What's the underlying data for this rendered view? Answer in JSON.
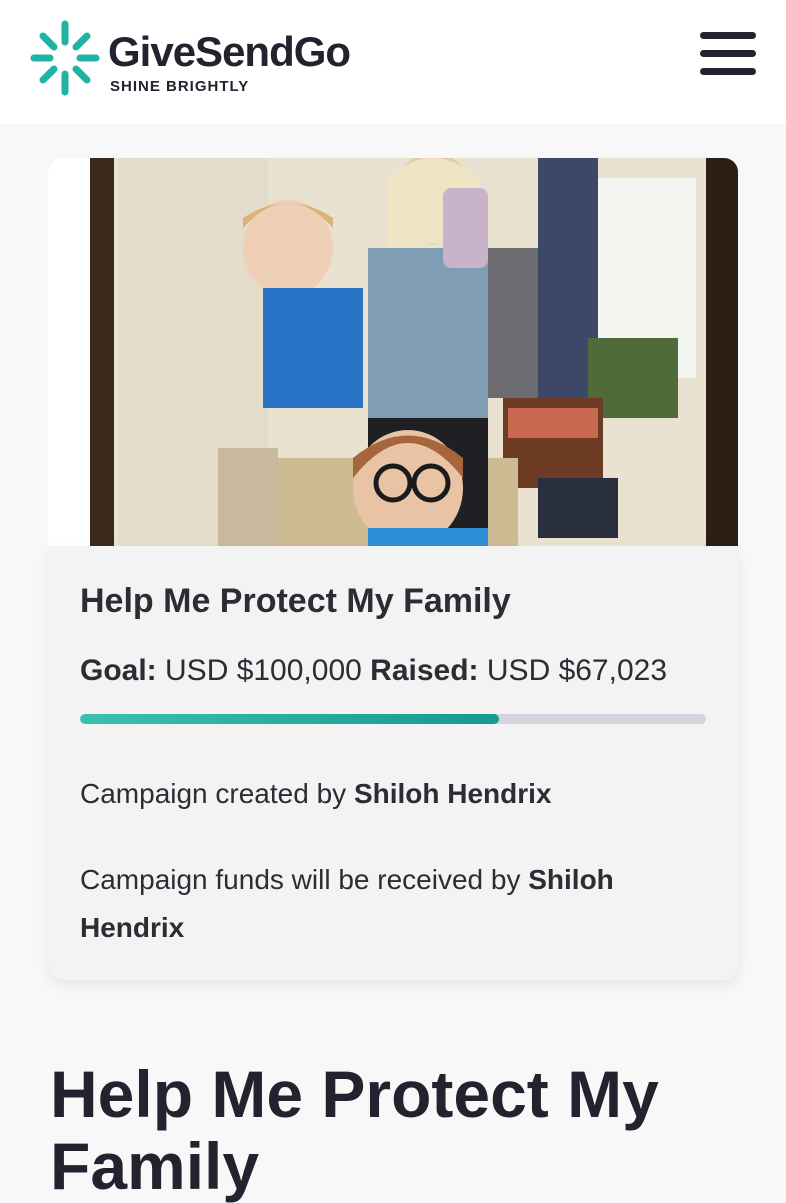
{
  "header": {
    "brand_name": "GiveSendGo",
    "tagline": "SHINE BRIGHTLY",
    "logo_icon": "burst-logo-icon",
    "menu_icon": "hamburger-menu-icon",
    "brand_color": "#1fb3a3"
  },
  "photo": {
    "alt": "Family selfie in a mirror"
  },
  "campaign_card": {
    "title": "Help Me Protect My Family",
    "goal_label": "Goal:",
    "goal_value": "USD $100,000",
    "raised_label": "Raised:",
    "raised_value": "USD $67,023",
    "progress_fraction": 0.67,
    "created_by_text": "Campaign created by",
    "creator_name": "Shiloh Hendrix",
    "funds_text": "Campaign funds will be received by",
    "recipient_name": "Shiloh Hendrix"
  },
  "main": {
    "title": "Help Me Protect My Family"
  }
}
